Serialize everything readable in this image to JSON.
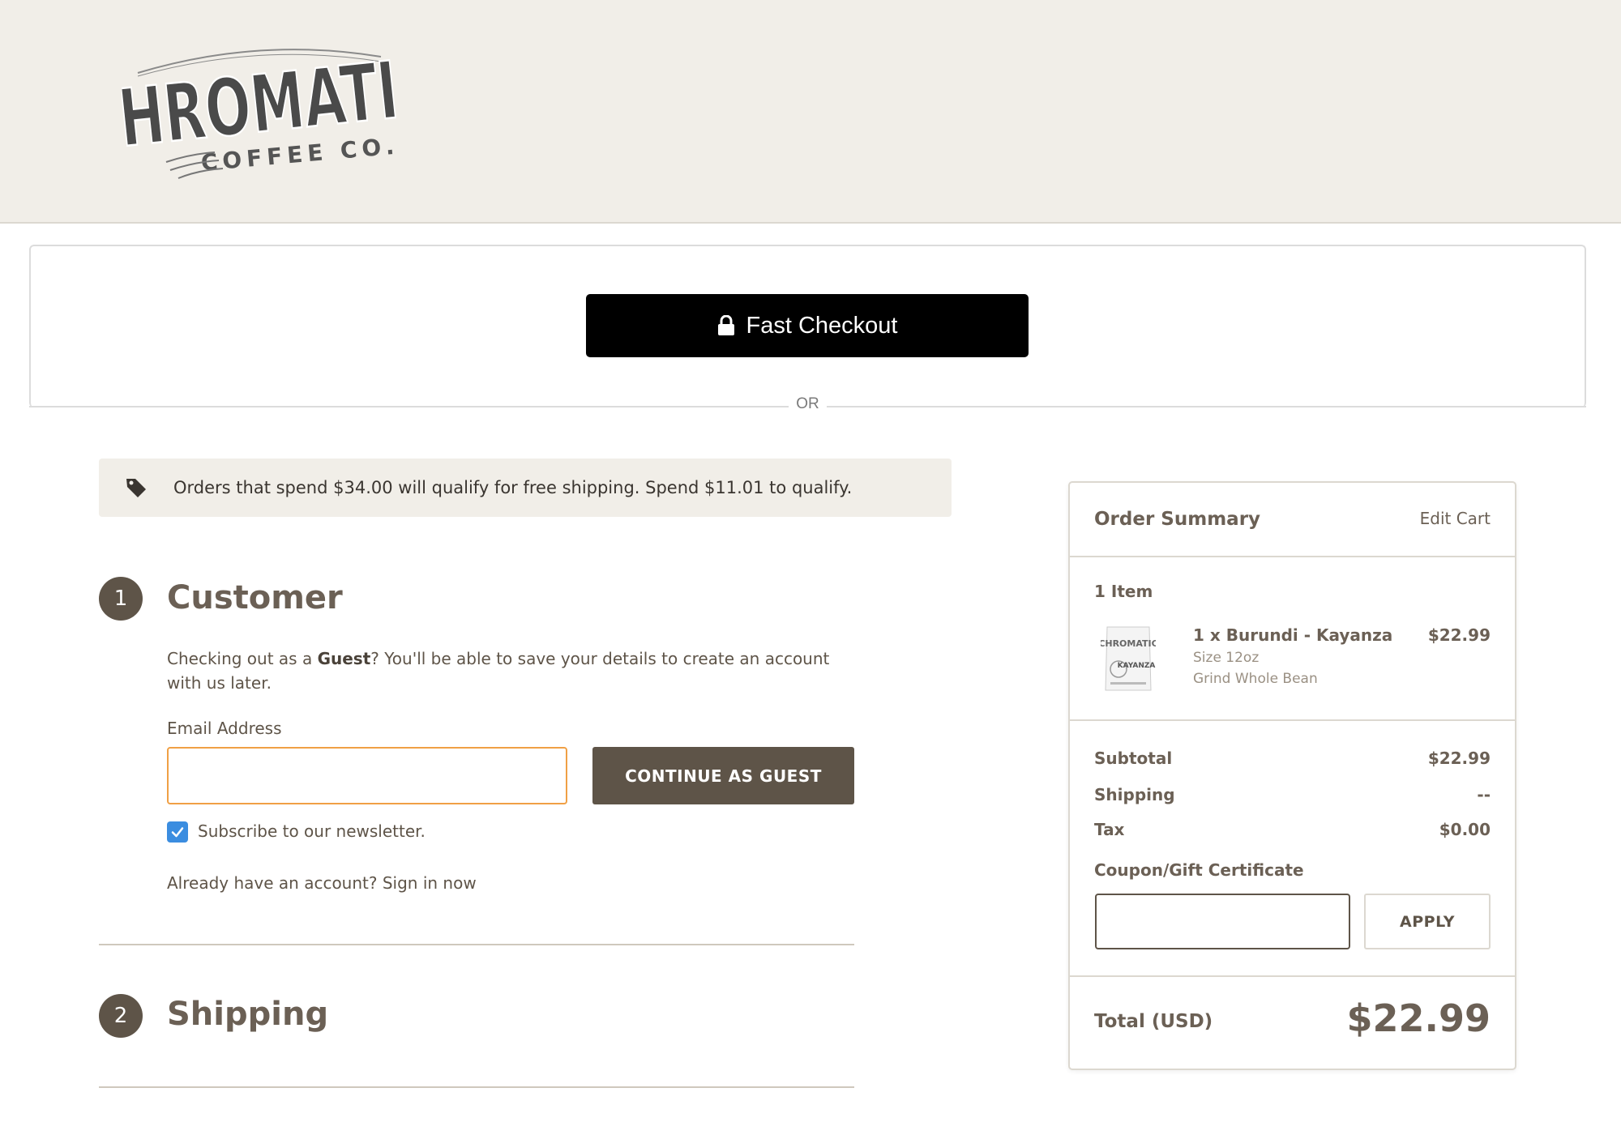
{
  "header": {
    "logo_line1": "CHROMATIC",
    "logo_line2": "COFFEE CO."
  },
  "fast_checkout": {
    "button_label": "Fast Checkout",
    "separator": "OR"
  },
  "banner": {
    "icon": "tag-icon",
    "text": "Orders that spend $34.00 will qualify for free shipping. Spend $11.01 to qualify."
  },
  "customer": {
    "step_number": "1",
    "title": "Customer",
    "guest_prefix": "Checking out as a ",
    "guest_bold": "Guest",
    "guest_suffix": "? You'll be able to save your details to create an account with us later.",
    "email_label": "Email Address",
    "email_value": "",
    "continue_label": "CONTINUE AS GUEST",
    "newsletter_checked": true,
    "newsletter_label": "Subscribe to our newsletter.",
    "account_prefix": "Already have an account? ",
    "signin_label": "Sign in now"
  },
  "shipping": {
    "step_number": "2",
    "title": "Shipping"
  },
  "order_summary": {
    "title": "Order Summary",
    "edit_label": "Edit Cart",
    "item_count": "1 Item",
    "items": [
      {
        "name": "1 x Burundi - Kayanza",
        "price": "$22.99",
        "options": [
          "Size 12oz",
          "Grind Whole Bean"
        ]
      }
    ],
    "subtotal_label": "Subtotal",
    "subtotal_value": "$22.99",
    "shipping_label": "Shipping",
    "shipping_value": "--",
    "tax_label": "Tax",
    "tax_value": "$0.00",
    "coupon_label": "Coupon/Gift Certificate",
    "coupon_value": "",
    "apply_label": "APPLY",
    "total_label": "Total (USD)",
    "total_value": "$22.99"
  },
  "colors": {
    "header_bg": "#f1eee8",
    "primary_brown": "#5e5448",
    "heading_brown": "#6b6055",
    "input_focus": "#f0a045",
    "checkbox_blue": "#3b8de0",
    "fast_checkout_bg": "#000000"
  }
}
